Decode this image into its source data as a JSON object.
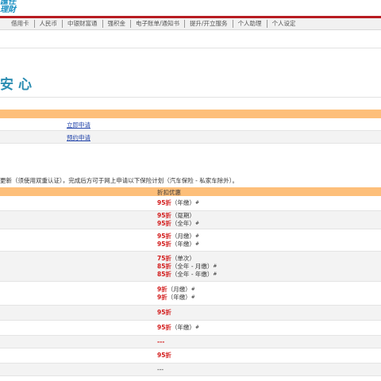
{
  "logo": {
    "line1": "匯任",
    "line2": "理財"
  },
  "nav": [
    "借用卡",
    "人民币",
    "中银财富通",
    "强积金",
    "电子账单/通知书",
    "提升/开立服务",
    "个人助理",
    "个人设定"
  ],
  "heading": "安心",
  "apply_links": [
    "立即申请",
    "预约申请"
  ],
  "notice": "更新（须使用双重认证），完成后方可于网上申请以下保险计划（汽车保险 - 私家车除外）。",
  "discount_header": "折扣优惠",
  "discount_rows": [
    {
      "lines": [
        {
          "pct": "95折",
          "note": "（年缴）",
          "hash": "#"
        }
      ]
    },
    {
      "lines": [
        {
          "pct": "95折",
          "note": "（趸期）",
          "hash": ""
        },
        {
          "pct": "95折",
          "note": "（全年）",
          "hash": "#"
        }
      ]
    },
    {
      "lines": [
        {
          "pct": "95折",
          "note": "（月缴）",
          "hash": "#"
        },
        {
          "pct": "95折",
          "note": "（年缴）",
          "hash": "#"
        }
      ]
    },
    {
      "lines": [
        {
          "pct": "75折",
          "note": "（单次）",
          "hash": ""
        },
        {
          "pct": "85折",
          "note": "（全年 - 月缴）",
          "hash": "#"
        },
        {
          "pct": "85折",
          "note": "（全年 - 年缴）",
          "hash": "#"
        }
      ]
    },
    {
      "lines": [
        {
          "pct": "9折",
          "note": "（月缴）",
          "hash": "#"
        },
        {
          "pct": "9折",
          "note": "（年缴）",
          "hash": "#"
        }
      ]
    },
    {
      "lines": [
        {
          "pct": "95折",
          "note": "",
          "hash": ""
        }
      ]
    },
    {
      "lines": [
        {
          "pct": "95折",
          "note": "（年缴）",
          "hash": "#"
        }
      ]
    },
    {
      "lines": [
        {
          "pct": "---",
          "note": "",
          "hash": ""
        }
      ]
    },
    {
      "lines": [
        {
          "pct": "95折",
          "note": "",
          "hash": ""
        }
      ]
    },
    {
      "lines": [
        {
          "pct": "---",
          "note": "",
          "hash": "",
          "plain": true
        }
      ]
    }
  ]
}
